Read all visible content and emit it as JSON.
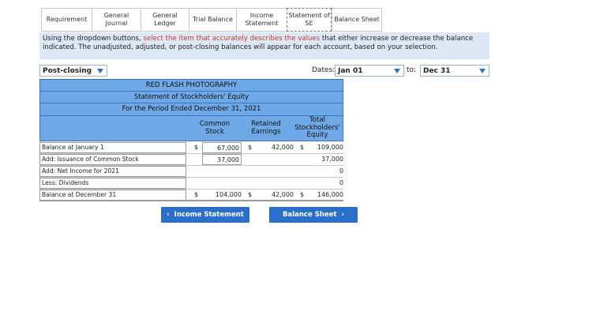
{
  "tabs": [
    {
      "label": "Requirement",
      "active": false
    },
    {
      "label": "General\nJournal",
      "active": false
    },
    {
      "label": "General\nLedger",
      "active": false
    },
    {
      "label": "Trial Balance",
      "active": false
    },
    {
      "label": "Income\nStatement",
      "active": false
    },
    {
      "label": "Statement of\nSE",
      "active": true
    },
    {
      "label": "Balance Sheet",
      "active": false
    }
  ],
  "instructions": {
    "part1": "Using the dropdown buttons, ",
    "highlight": "select the item that accurately describes the values",
    "part2": " that either increase or decrease the  balance indicated. The unadjusted, adjusted, or post-closing balances will appear for each account, based on your selection."
  },
  "controls": {
    "balance_type": "Post-closing",
    "dates_label": "Dates:",
    "from_date": "Jan 01",
    "to_label": "to:",
    "to_date": "Dec 31"
  },
  "statement": {
    "company": "RED FLASH PHOTOGRAPHY",
    "title": "Statement of Stockholders' Equity",
    "period": "For the Period Ended December 31, 2021",
    "columns": {
      "common_stock": "Common\nStock",
      "retained_earnings": "Retained\nEarnings",
      "total": "Total\nStockholders'\nEquity"
    },
    "rows": [
      {
        "label": "Balance at January 1",
        "cs_cur": "$",
        "cs": "67,000",
        "re_cur": "$",
        "re": "42,000",
        "tot_cur": "$",
        "tot": "109,000"
      },
      {
        "label": "Add: Issuance of Common Stock",
        "cs_cur": "",
        "cs": "37,000",
        "re_cur": "",
        "re": "",
        "tot_cur": "",
        "tot": "37,000"
      },
      {
        "label": "Add: Net Income for 2021",
        "cs_cur": "",
        "cs": "",
        "re_cur": "",
        "re": "",
        "tot_cur": "",
        "tot": "0"
      },
      {
        "label": "Less: Dividends",
        "cs_cur": "",
        "cs": "",
        "re_cur": "",
        "re": "",
        "tot_cur": "",
        "tot": "0"
      },
      {
        "label": "Balance at December 31",
        "cs_cur": "$",
        "cs": "104,000",
        "re_cur": "$",
        "re": "42,000",
        "tot_cur": "$",
        "tot": "146,000"
      }
    ]
  },
  "nav": {
    "prev_label": "Income Statement",
    "next_label": "Balance Sheet"
  },
  "colors": {
    "header_blue": "#6fa8e6",
    "button_blue": "#2c6fc9",
    "instruction_bg": "#dde8f6",
    "highlight_red": "#c0392b"
  }
}
